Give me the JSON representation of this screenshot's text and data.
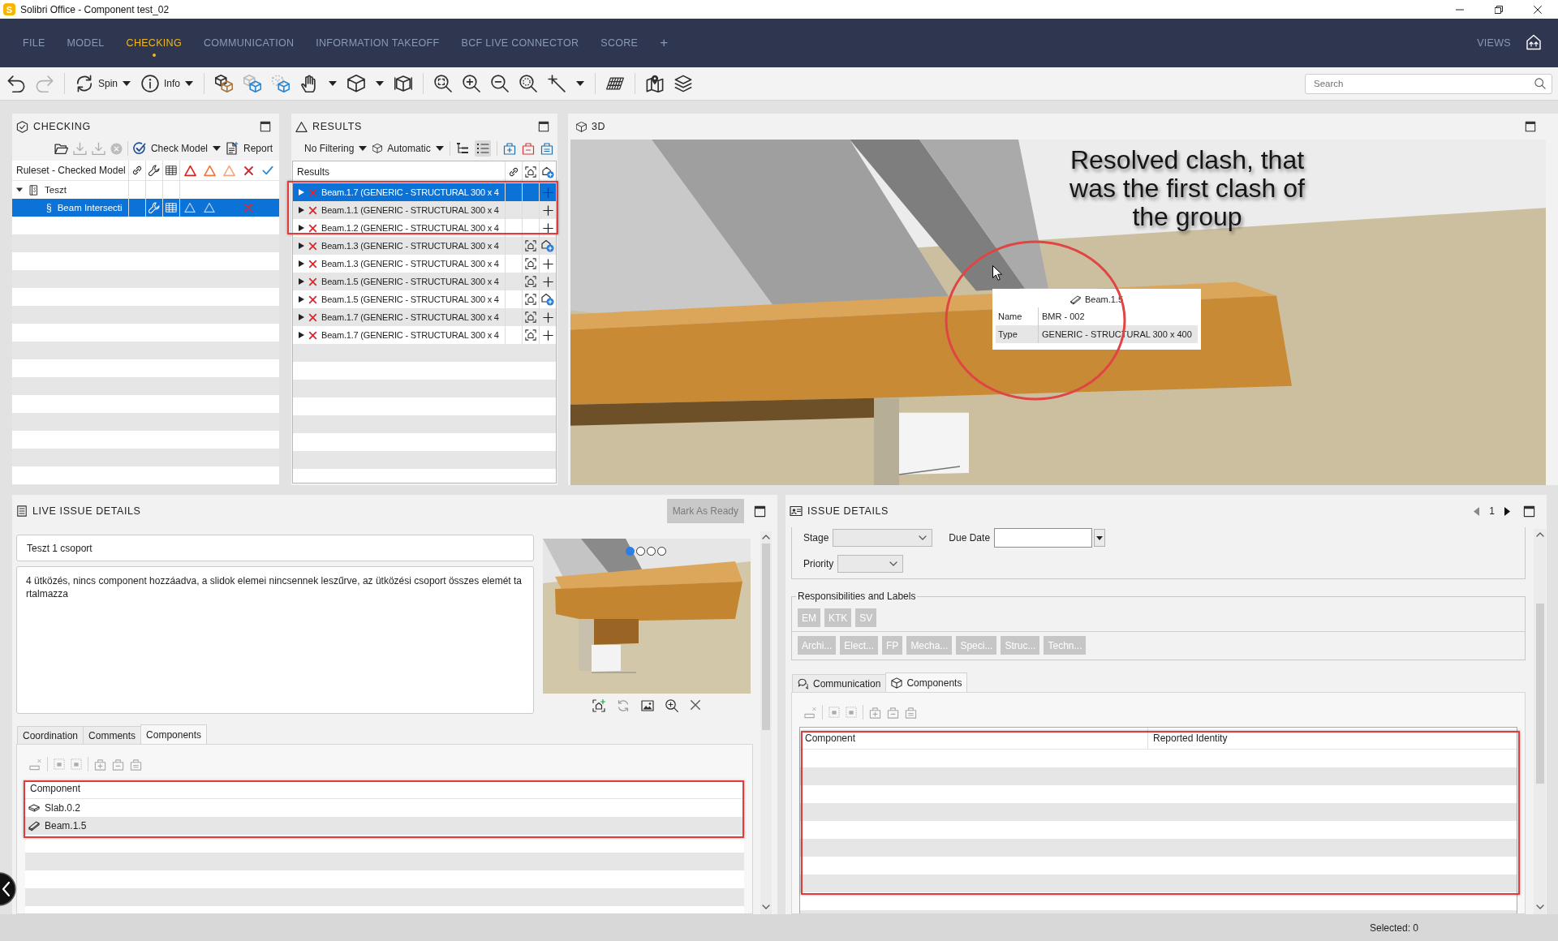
{
  "window": {
    "logo": "S",
    "title": "Solibri Office - Component test_02"
  },
  "menu": {
    "tabs": [
      {
        "label": "FILE",
        "selected": false
      },
      {
        "label": "MODEL",
        "selected": false
      },
      {
        "label": "CHECKING",
        "selected": true
      },
      {
        "label": "COMMUNICATION",
        "selected": false
      },
      {
        "label": "INFORMATION TAKEOFF",
        "selected": false
      },
      {
        "label": "BCF LIVE CONNECTOR",
        "selected": false
      },
      {
        "label": "SCORE",
        "selected": false
      }
    ],
    "add_tab": "+",
    "views": "VIEWS"
  },
  "toolbar": {
    "spin": "Spin",
    "info": "Info",
    "search": {
      "placeholder": "Search"
    }
  },
  "checking": {
    "title": "CHECKING",
    "check_model": "Check Model",
    "report": "Report",
    "column": "Ruleset - Checked Model",
    "tree": [
      {
        "label": "Teszt",
        "expanded": true,
        "selected": false,
        "children": [
          {
            "symbol": "§",
            "label": "Beam Intersecti",
            "selected": true
          }
        ]
      }
    ]
  },
  "results": {
    "title": "RESULTS",
    "filter": "No Filtering",
    "mode": "Automatic",
    "column": "Results",
    "rows": [
      {
        "label": "Beam.1.7 (GENERIC - STRUCTURAL 300 x 4",
        "selected": true,
        "has_viewpoint": false,
        "in_issue": false
      },
      {
        "label": "Beam.1.1 (GENERIC - STRUCTURAL 300 x 4",
        "selected": false,
        "has_viewpoint": false,
        "in_issue": false
      },
      {
        "label": "Beam.1.2 (GENERIC - STRUCTURAL 300 x 4",
        "selected": false,
        "has_viewpoint": false,
        "in_issue": false
      },
      {
        "label": "Beam.1.3 (GENERIC - STRUCTURAL 300 x 4",
        "selected": false,
        "has_viewpoint": true,
        "in_issue": true
      },
      {
        "label": "Beam.1.3 (GENERIC - STRUCTURAL 300 x 4",
        "selected": false,
        "has_viewpoint": true,
        "in_issue": false
      },
      {
        "label": "Beam.1.5 (GENERIC - STRUCTURAL 300 x 4",
        "selected": false,
        "has_viewpoint": true,
        "in_issue": false
      },
      {
        "label": "Beam.1.5 (GENERIC - STRUCTURAL 300 x 4",
        "selected": false,
        "has_viewpoint": true,
        "in_issue": true
      },
      {
        "label": "Beam.1.7 (GENERIC - STRUCTURAL 300 x 4",
        "selected": false,
        "has_viewpoint": true,
        "in_issue": false
      },
      {
        "label": "Beam.1.7 (GENERIC - STRUCTURAL 300 x 4",
        "selected": false,
        "has_viewpoint": true,
        "in_issue": false
      }
    ]
  },
  "view_3d": {
    "title": "3D",
    "annotation": "Resolved clash, that was the first clash of the group",
    "tooltip": {
      "title": "Beam.1.5",
      "rows": [
        {
          "key": "Name",
          "value": "BMR - 002"
        },
        {
          "key": "Type",
          "value": "GENERIC - STRUCTURAL 300 x 400"
        }
      ]
    }
  },
  "live_issue": {
    "title": "LIVE ISSUE DETAILS",
    "mark_ready": {
      "label": "Mark As Ready",
      "disabled": true
    },
    "name": "Teszt 1 csoport",
    "description": "4 ütközés, nincs component hozzáadva, a slidok elemei nincsennek leszűrve, az ütközési csoport összes elemét tartalmazza",
    "slides": [
      {
        "selected": true
      },
      {
        "selected": false
      },
      {
        "selected": false
      },
      {
        "selected": false
      }
    ],
    "tabs": [
      {
        "label": "Coordination",
        "selected": false
      },
      {
        "label": "Comments",
        "selected": false
      },
      {
        "label": "Components",
        "selected": true
      }
    ],
    "table": {
      "columns": [
        "Component"
      ],
      "rows": [
        {
          "kind": "slab",
          "label": "Slab.0.2"
        },
        {
          "kind": "beam",
          "label": "Beam.1.5"
        }
      ]
    }
  },
  "issue_details": {
    "title": "ISSUE DETAILS",
    "page": "1",
    "stage": {
      "label": "Stage"
    },
    "due_date": {
      "label": "Due Date"
    },
    "priority": {
      "label": "Priority"
    },
    "responsibilities_group": {
      "title": "Responsibilities and Labels",
      "responsibilities": [
        "EM",
        "KTK",
        "SV"
      ],
      "labels": [
        "Archi...",
        "Elect...",
        "FP",
        "Mecha...",
        "Speci...",
        "Struc...",
        "Techn..."
      ]
    },
    "tabs": [
      {
        "label": "Communication",
        "kind": "chat",
        "selected": false
      },
      {
        "label": "Components",
        "kind": "components",
        "selected": true
      }
    ],
    "table": {
      "columns": [
        "Component",
        "Reported Identity"
      ]
    }
  },
  "status_bar": {
    "selected": "Selected: 0"
  }
}
